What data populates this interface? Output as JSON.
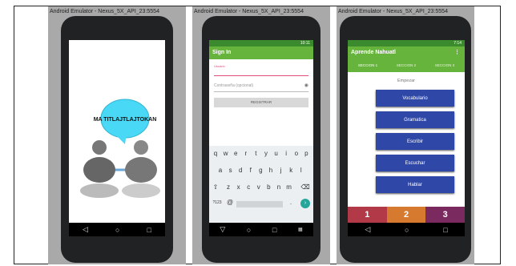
{
  "emulators": [
    {
      "title": "Android Emulator - Nexus_5X_API_23:5554"
    },
    {
      "title": "Android Emulator - Nexus_5X_API_23:5554"
    },
    {
      "title": "Android Emulator - Nexus_5X_API_23:5554"
    }
  ],
  "splash": {
    "bubble_text": "MA TITLAJTLAJTOKAN"
  },
  "signin": {
    "status_time": "10:11",
    "title": "Sign In",
    "email_label": "Usuario",
    "password_placeholder": "Contraseña (opcional)",
    "register_label": "REGISTRAR",
    "keyboard_rows": [
      [
        "q",
        "w",
        "e",
        "r",
        "t",
        "y",
        "u",
        "i",
        "o",
        "p"
      ],
      [
        "a",
        "s",
        "d",
        "f",
        "g",
        "h",
        "j",
        "k",
        "l"
      ],
      [
        "z",
        "x",
        "c",
        "v",
        "b",
        "n",
        "m"
      ]
    ],
    "symbols_key": "?123",
    "at_key": "@",
    "period_key": "."
  },
  "main": {
    "status_time": "7:14",
    "title": "Aprende Nahuatl",
    "menu_icon": "⋮",
    "tabs": [
      "SECCION 1",
      "SECCION 2",
      "SECCION 3"
    ],
    "heading": "Empezar",
    "buttons": [
      "Vocabulario",
      "Gramatica",
      "Escribir",
      "Escuchar",
      "Hablar"
    ],
    "banner_numbers": [
      "1",
      "2",
      "3"
    ]
  },
  "nav_icons": {
    "back": "◁",
    "home": "○",
    "recent": "□"
  },
  "colors": {
    "appbar": "#67b43c",
    "statusbar": "#3c8a2e",
    "button": "#2f48a8",
    "bubble": "#49d8f5"
  }
}
